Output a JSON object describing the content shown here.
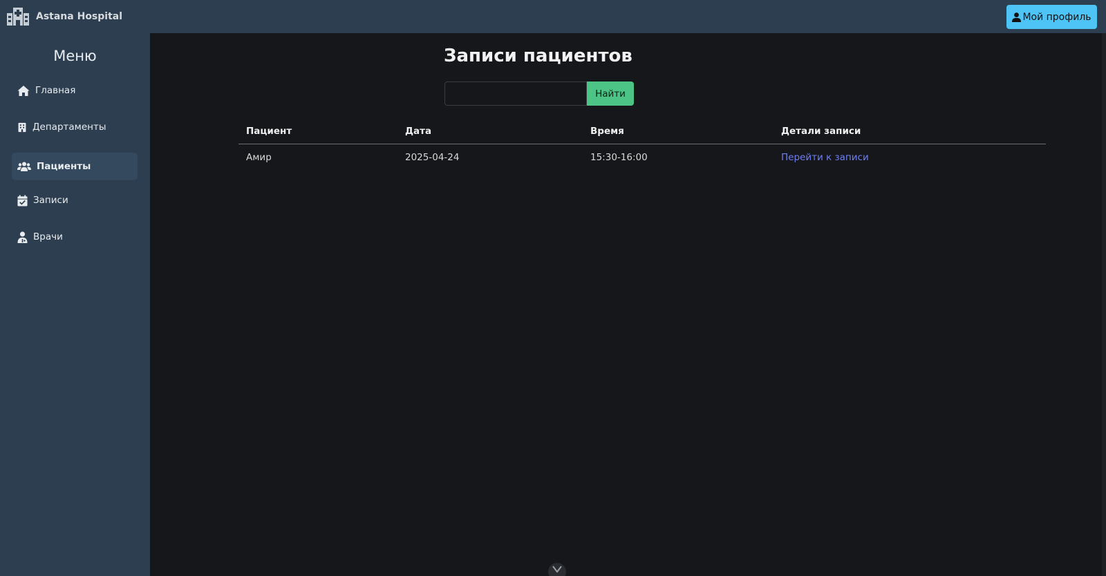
{
  "brand": {
    "name": "Astana Hospital"
  },
  "header": {
    "profile_label": "Мой профиль"
  },
  "sidebar": {
    "title": "Меню",
    "items": [
      {
        "label": "Главная",
        "icon": "home-icon",
        "active": false
      },
      {
        "label": "Департаменты",
        "icon": "building-icon",
        "active": false
      },
      {
        "label": "Пациенты",
        "icon": "users-icon",
        "active": true
      },
      {
        "label": "Записи",
        "icon": "calendar-check-icon",
        "active": false
      },
      {
        "label": "Врачи",
        "icon": "doctor-icon",
        "active": false
      }
    ]
  },
  "main": {
    "title": "Записи пациентов",
    "search": {
      "value": "",
      "placeholder": "",
      "button_label": "Найти"
    },
    "table": {
      "headers": [
        "Пациент",
        "Дата",
        "Время",
        "Детали записи"
      ],
      "rows": [
        {
          "patient": "Амир",
          "date": "2025-04-24",
          "time": "15:30-16:00",
          "link": "Перейти к записи"
        }
      ]
    }
  },
  "colors": {
    "accent_green": "#4cc486",
    "accent_blue": "#4dc4f5",
    "link": "#6f7ff0",
    "sidebar_bg": "#2c3e50",
    "page_bg": "#16171b"
  }
}
